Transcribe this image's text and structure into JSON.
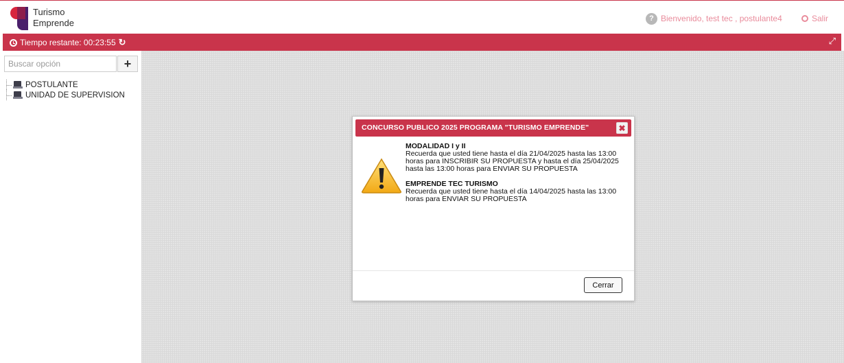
{
  "header": {
    "logo_line1": "Turismo",
    "logo_line2": "Emprende",
    "welcome_text": "Bienvenido, test tec , postulante4",
    "logout_label": "Salir"
  },
  "timerbar": {
    "label": "Tiempo restante: 00:23:55"
  },
  "sidebar": {
    "search_placeholder": "Buscar opción",
    "add_label": "+",
    "tree": [
      {
        "label": "POSTULANTE"
      },
      {
        "label": "UNIDAD DE SUPERVISION"
      }
    ]
  },
  "modal": {
    "title": "CONCURSO PUBLICO 2025 PROGRAMA \"TURISMO EMPRENDE\"",
    "close_symbol": "✖",
    "sections": [
      {
        "heading": "MODALIDAD I y II",
        "text": "Recuerda que usted tiene hasta el día 21/04/2025 hasta las 13:00 horas para INSCRIBIR SU PROPUESTA y hasta el día 25/04/2025 hasta las 13:00 horas para ENVIAR SU PROPUESTA"
      },
      {
        "heading": "EMPRENDE TEC TURISMO",
        "text": "Recuerda que usted tiene hasta el día 14/04/2025 hasta las 13:00 horas para ENVIAR SU PROPUESTA"
      }
    ],
    "close_button": "Cerrar"
  },
  "colors": {
    "brand_red": "#c9344b",
    "logo_purple": "#4a1f6b",
    "link_pink": "#e98b9b"
  }
}
